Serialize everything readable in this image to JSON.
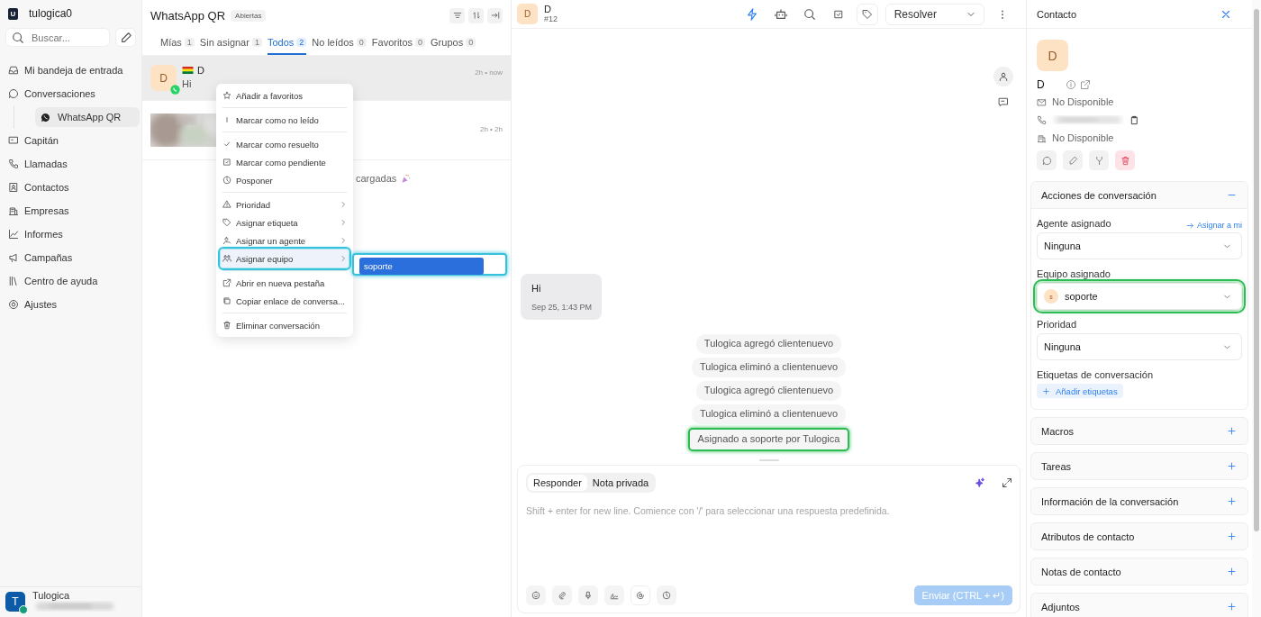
{
  "workspace": {
    "logo": "U",
    "name": "tulogica0"
  },
  "search": {
    "placeholder": "Buscar..."
  },
  "nav": [
    {
      "label": "Mi bandeja de entrada"
    },
    {
      "label": "Conversaciones",
      "children": [
        {
          "label": "WhatsApp QR",
          "selected": true
        }
      ]
    },
    {
      "label": "Capitán"
    },
    {
      "label": "Llamadas"
    },
    {
      "label": "Contactos"
    },
    {
      "label": "Empresas"
    },
    {
      "label": "Informes"
    },
    {
      "label": "Campañas"
    },
    {
      "label": "Centro de ayuda"
    },
    {
      "label": "Ajustes"
    }
  ],
  "user": {
    "initial": "T",
    "name": "Tulogica"
  },
  "list": {
    "title": "WhatsApp QR",
    "status": "Abiertas",
    "tabs": [
      {
        "label": "Mías",
        "count": "1",
        "selected": false
      },
      {
        "label": "Sin asignar",
        "count": "1",
        "selected": false
      },
      {
        "label": "Todos",
        "count": "2",
        "selected": true
      },
      {
        "label": "No leídos",
        "count": "0",
        "selected": false
      },
      {
        "label": "Favoritos",
        "count": "0",
        "selected": false
      },
      {
        "label": "Grupos",
        "count": "0",
        "selected": false
      }
    ],
    "conversations": [
      {
        "kind": "contact",
        "initial": "D",
        "name": "D",
        "preview": "Hi",
        "time": "2h • now",
        "selected": true
      },
      {
        "kind": "picture",
        "time": "2h • 2h",
        "selected": false
      }
    ],
    "footer_text": "cargadas"
  },
  "menu": {
    "groups": [
      [
        {
          "label": "Añadir a favoritos",
          "submenu": false,
          "highlighted": false
        }
      ],
      [
        {
          "label": "Marcar como no leído",
          "submenu": false,
          "highlighted": false
        }
      ],
      [
        {
          "label": "Marcar como resuelto",
          "submenu": false,
          "highlighted": false
        },
        {
          "label": "Marcar como pendiente",
          "submenu": false,
          "highlighted": false
        },
        {
          "label": "Posponer",
          "submenu": false,
          "highlighted": false
        }
      ],
      [
        {
          "label": "Prioridad",
          "submenu": true,
          "highlighted": false
        },
        {
          "label": "Asignar etiqueta",
          "submenu": true,
          "highlighted": false
        },
        {
          "label": "Asignar un agente",
          "submenu": true,
          "highlighted": false
        },
        {
          "label": "Asignar equipo",
          "submenu": true,
          "highlighted": true
        }
      ],
      [
        {
          "label": "Abrir en nueva pestaña",
          "submenu": false,
          "highlighted": false
        },
        {
          "label": "Copiar enlace de conversa...",
          "submenu": false,
          "highlighted": false
        }
      ],
      [
        {
          "label": "Eliminar conversación",
          "submenu": false,
          "highlighted": false
        }
      ]
    ],
    "submenu": {
      "highlighted": true,
      "items": [
        {
          "label": "soporte",
          "selected": true
        }
      ]
    }
  },
  "chat": {
    "initial": "D",
    "name": "D",
    "number": "#12",
    "resolve": "Resolver",
    "messages": [
      {
        "text": "Hi",
        "time": "Sep 25, 1:43 PM"
      }
    ],
    "activities": [
      {
        "text": "Tulogica agregó clientenuevo",
        "highlighted": false
      },
      {
        "text": "Tulogica eliminó a clientenuevo",
        "highlighted": false
      },
      {
        "text": "Tulogica agregó clientenuevo",
        "highlighted": false
      },
      {
        "text": "Tulogica eliminó a clientenuevo",
        "highlighted": false
      },
      {
        "text": "Asignado a soporte por Tulogica",
        "highlighted": true
      }
    ]
  },
  "composer": {
    "tabs": [
      {
        "label": "Responder",
        "selected": true
      },
      {
        "label": "Nota privada",
        "selected": false
      }
    ],
    "placeholder": "Shift + enter for new line. Comience con '/' para seleccionar una respuesta predefinida.",
    "send": {
      "label": "Enviar (CTRL + ↵)",
      "disabled": true
    }
  },
  "contact": {
    "title": "Contacto",
    "initial": "D",
    "name": "D",
    "email": "No Disponible",
    "company": "No Disponible",
    "sections": [
      {
        "title": "Acciones de conversación",
        "expanded": true,
        "fields": [
          {
            "label": "Agente asignado",
            "link": "Asignar a mi",
            "value": "Ninguna",
            "highlighted": false
          },
          {
            "label": "Equipo asignado",
            "avatar": "s",
            "value": "soporte",
            "highlighted": true
          },
          {
            "label": "Prioridad",
            "value": "Ninguna",
            "highlighted": false
          }
        ],
        "tags_label": "Etiquetas de conversación",
        "add_tags": "Añadir etiquetas"
      },
      {
        "title": "Macros",
        "expanded": false
      },
      {
        "title": "Tareas",
        "expanded": false
      },
      {
        "title": "Información de la conversación",
        "expanded": false
      },
      {
        "title": "Atributos de contacto",
        "expanded": false
      },
      {
        "title": "Notas de contacto",
        "expanded": false
      },
      {
        "title": "Adjuntos",
        "expanded": false
      }
    ]
  }
}
